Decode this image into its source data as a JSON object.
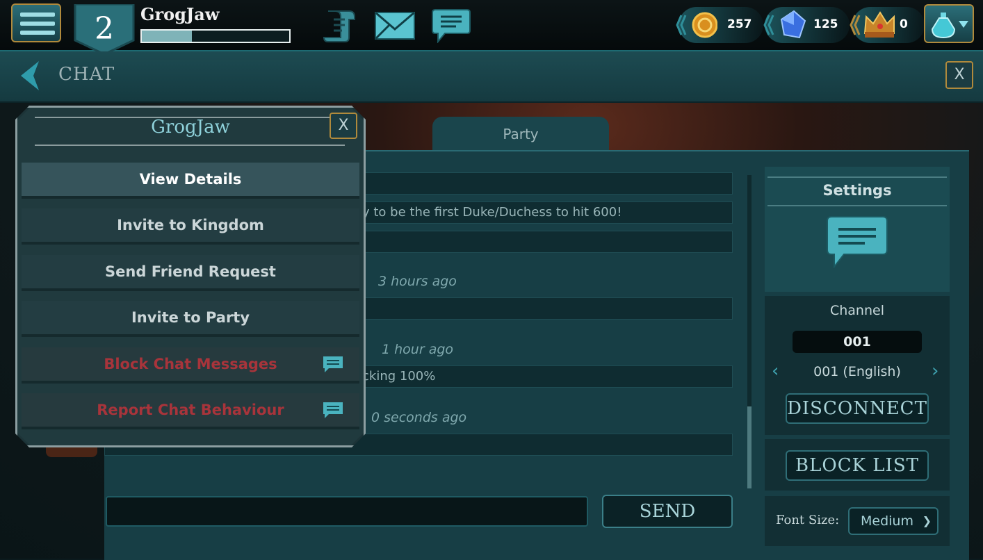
{
  "player": {
    "level": "2",
    "name": "GrogJaw",
    "xp_fraction": 0.34
  },
  "resources": [
    {
      "name": "gold",
      "icon": "gold-coin-icon",
      "value": "257"
    },
    {
      "name": "gems",
      "icon": "gem-icon",
      "value": "125"
    },
    {
      "name": "crowns",
      "icon": "crown-icon",
      "value": "0"
    }
  ],
  "header": {
    "title": "CHAT",
    "close_label": "X"
  },
  "tabs": {
    "party": "Party"
  },
  "messages": [
    {
      "text": "",
      "time": ""
    },
    {
      "text": "y to be the first Duke/Duchess to hit 600!",
      "time": ""
    },
    {
      "text": "",
      "time": ""
    },
    {
      "text": "",
      "time": "3 hours ago"
    },
    {
      "text": "",
      "time": "1 hour ago"
    },
    {
      "text": "cking 100%",
      "time": ""
    },
    {
      "text": "",
      "time": "0 seconds ago"
    },
    {
      "text": "",
      "time": ""
    }
  ],
  "composer": {
    "send_label": "SEND"
  },
  "settings": {
    "title": "Settings",
    "channel_label": "Channel",
    "channel_value": "001",
    "channel_name": "001 (English)",
    "disconnect_label": "DISCONNECT",
    "block_list_label": "BLOCK LIST",
    "font_size_label": "Font Size:",
    "font_size_value": "Medium"
  },
  "popup": {
    "title": "GrogJaw",
    "close_label": "X",
    "items": [
      {
        "label": "View Details"
      },
      {
        "label": "Invite to Kingdom"
      },
      {
        "label": "Send Friend Request"
      },
      {
        "label": "Invite to Party"
      },
      {
        "label": "Block Chat Messages"
      },
      {
        "label": "Report Chat Behaviour"
      }
    ]
  },
  "colors": {
    "accent": "#2fa0ad",
    "danger": "#a8343b",
    "gold_border": "#b08a3c"
  }
}
